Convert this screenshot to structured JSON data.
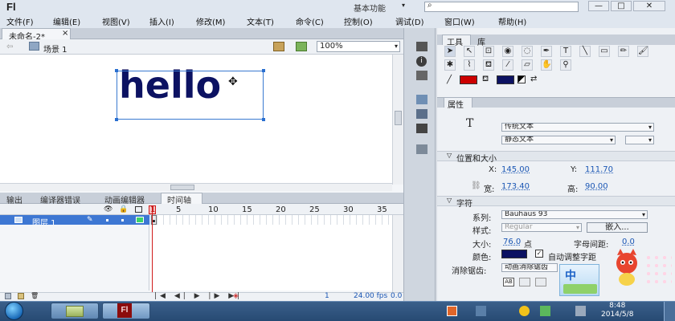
{
  "app": {
    "logo": "Fl",
    "workspace": "基本功能",
    "workspace_arrow": "▾",
    "search_icon": "⌕"
  },
  "window_buttons": {
    "minimize": "—",
    "maximize": "□",
    "close": "✕"
  },
  "menu": [
    "文件(F)",
    "编辑(E)",
    "视图(V)",
    "插入(I)",
    "修改(M)",
    "文本(T)",
    "命令(C)",
    "控制(O)",
    "调试(D)",
    "窗口(W)",
    "帮助(H)"
  ],
  "document": {
    "tab_title": "未命名-2*",
    "tab_close": "×",
    "scene": "场景 1",
    "zoom": "100%"
  },
  "stage": {
    "text": "hello",
    "text_color": "#0c1262",
    "selection_color": "#2a6fd0"
  },
  "bottom_tabs": [
    "输出",
    "编译器错误",
    "动画编辑器",
    "时间轴"
  ],
  "timeline": {
    "frame_numbers": [
      "1",
      "5",
      "10",
      "15",
      "20",
      "25",
      "30",
      "35"
    ],
    "layer_name": "图层 1",
    "current_frame": "1",
    "fps": "24.00 fps",
    "elapsed": "0.0 s",
    "footer_frame": "1"
  },
  "tools_panel": {
    "tabs": [
      "工具",
      "库"
    ],
    "stroke_color": "#cc0000",
    "fill_color": "#0c1262"
  },
  "properties": {
    "tab": "属性",
    "text_icon": "T",
    "text_type": "传统文本",
    "text_subtype": "静态文本",
    "section_position": "位置和大小",
    "x_label": "X:",
    "x_value": "145.00",
    "y_label": "Y:",
    "y_value": "111.70",
    "w_label": "宽:",
    "w_value": "173.40",
    "h_label": "高:",
    "h_value": "90.00",
    "section_char": "字符",
    "family_label": "系列:",
    "family_value": "Bauhaus 93",
    "style_label": "样式:",
    "style_value": "Regular",
    "embed_button": "嵌入...",
    "size_label": "大小:",
    "size_value": "76.0",
    "size_unit": "点",
    "spacing_label": "字母间距:",
    "spacing_value": "0.0",
    "color_label": "颜色:",
    "auto_kern": "自动调整字距",
    "antialias_label": "消除锯齿:",
    "antialias_value": "动画消除锯齿"
  },
  "taskbar": {
    "time": "8:48",
    "date": "2014/5/8",
    "ime_label": "中"
  }
}
